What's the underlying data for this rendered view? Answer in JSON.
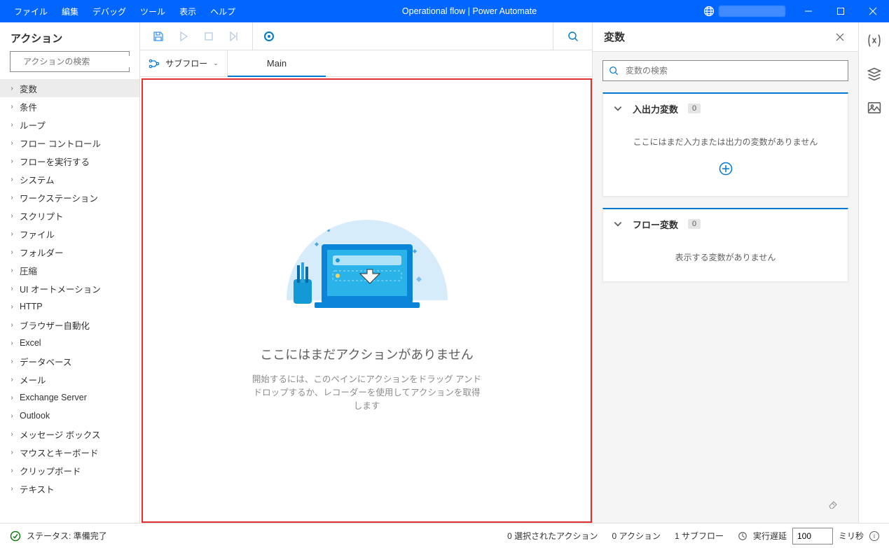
{
  "title": "Operational flow | Power Automate",
  "menu": [
    "ファイル",
    "編集",
    "デバッグ",
    "ツール",
    "表示",
    "ヘルプ"
  ],
  "sidebar": {
    "title": "アクション",
    "search_placeholder": "アクションの検索",
    "items": [
      "変数",
      "条件",
      "ループ",
      "フロー コントロール",
      "フローを実行する",
      "システム",
      "ワークステーション",
      "スクリプト",
      "ファイル",
      "フォルダー",
      "圧縮",
      "UI オートメーション",
      "HTTP",
      "ブラウザー自動化",
      "Excel",
      "データベース",
      "メール",
      "Exchange Server",
      "Outlook",
      "メッセージ ボックス",
      "マウスとキーボード",
      "クリップボード",
      "テキスト"
    ]
  },
  "tabs": {
    "subflow": "サブフロー",
    "main": "Main"
  },
  "canvas_empty": {
    "title": "ここにはまだアクションがありません",
    "body": "開始するには、このペインにアクションをドラッグ アンド ドロップするか、レコーダーを使用してアクションを取得します"
  },
  "right": {
    "title": "変数",
    "search_placeholder": "変数の検索",
    "io_vars": {
      "title": "入出力変数",
      "count": "0",
      "empty": "ここにはまだ入力または出力の変数がありません"
    },
    "flow_vars": {
      "title": "フロー変数",
      "count": "0",
      "empty": "表示する変数がありません"
    }
  },
  "status": {
    "ready_label": "ステータス:",
    "ready_value": "準備完了",
    "selected": "0 選択されたアクション",
    "actions": "0 アクション",
    "subflows": "1 サブフロー",
    "delay_label": "実行遅延",
    "delay_value": "100",
    "delay_unit": "ミリ秒"
  }
}
